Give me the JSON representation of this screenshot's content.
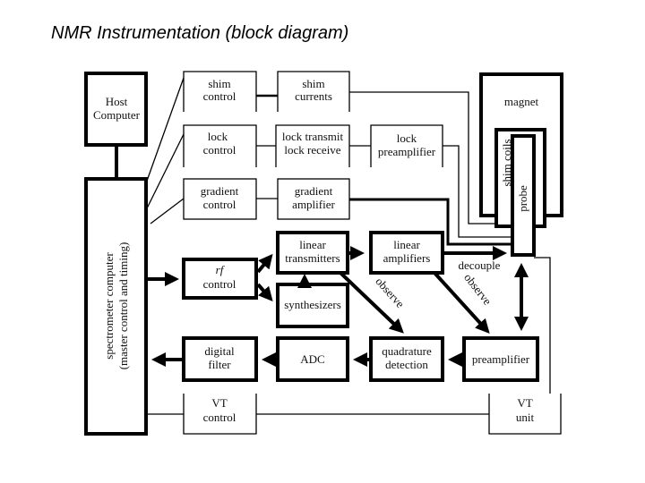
{
  "title": "NMR Instrumentation (block diagram)",
  "blocks": {
    "host": [
      "Host",
      "Computer"
    ],
    "spectrometer": [
      "spectrometer computer",
      "(master control and timing)"
    ],
    "shim_control": [
      "shim",
      "control"
    ],
    "shim_currents": [
      "shim",
      "currents"
    ],
    "lock_control": [
      "lock",
      "control"
    ],
    "lock_tx_rx": [
      "lock transmit",
      "lock receive"
    ],
    "lock_preamp": [
      "lock",
      "preamplifier"
    ],
    "gradient_control": [
      "gradient",
      "control"
    ],
    "gradient_amp": [
      "gradient",
      "amplifier"
    ],
    "magnet": "magnet",
    "shim_coils": "shim coils",
    "probe": "probe",
    "rf_control": [
      "rf",
      "control"
    ],
    "linear_tx": [
      "linear",
      "transmitters"
    ],
    "synthesizers": "synthesizers",
    "linear_amp": [
      "linear",
      "amplifiers"
    ],
    "digital_filter": [
      "digital",
      "filter"
    ],
    "adc": "ADC",
    "quadrature": [
      "quadrature",
      "detection"
    ],
    "preamplifier": "preamplifier",
    "vt_control": [
      "VT",
      "control"
    ],
    "vt_unit": [
      "VT",
      "unit"
    ]
  },
  "labels": {
    "decouple": "decouple",
    "observe_1": "observe",
    "observe_2": "observe"
  }
}
